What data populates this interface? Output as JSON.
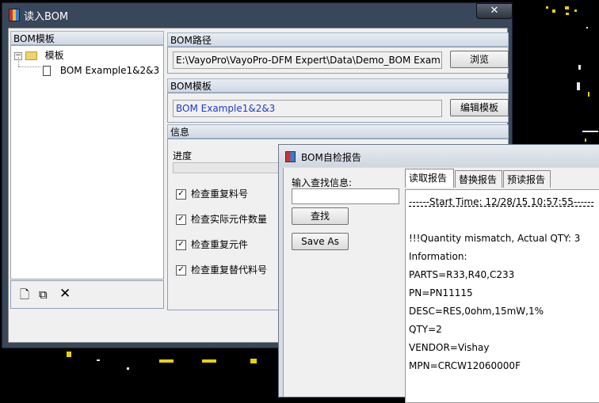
{
  "main_window": {
    "title": "读入BOM",
    "close_label": "✕",
    "left_panel": {
      "header": "BOM模板",
      "tree": {
        "expander": "−",
        "root_label": "模板",
        "child_label": "BOM Example1&2&3"
      }
    },
    "bom_path": {
      "header": "BOM路径",
      "value": "E:\\VayoPro\\VayoPro-DFM Expert\\Data\\Demo_BOM Example",
      "browse_label": "浏览"
    },
    "bom_template": {
      "header": "BOM模板",
      "value": "BOM Example1&2&3",
      "edit_label": "编辑模板"
    },
    "info": {
      "header": "信息",
      "progress_label": "进度",
      "checks": [
        {
          "label": "检查重复料号",
          "checked": true
        },
        {
          "label": "检查实际元件数量",
          "checked": true
        },
        {
          "label": "检查重复元件",
          "checked": true
        },
        {
          "label": "检查重复替代料号",
          "checked": true
        }
      ]
    },
    "toolbar_icons": [
      "new-document-icon",
      "copy-icon",
      "delete-icon"
    ]
  },
  "report_window": {
    "title": "BOM自检报告",
    "search_label": "输入查找信息:",
    "search_value": "",
    "find_button": "查找",
    "save_as_button": "Save As",
    "tabs": [
      "读取报告",
      "替换报告",
      "预读报告"
    ],
    "active_tab": 0,
    "lines": [
      "------Start Time: 12/28/15 10:57:55------",
      "",
      "!!!Quantity mismatch, Actual QTY: 3",
      "Information:",
      " PARTS=R33,R40,C233",
      " PN=PN11115",
      " DESC=RES,0ohm,15mW,1%",
      " QTY=2",
      " VENDOR=Vishay",
      " MPN=CRCW12060000F"
    ]
  },
  "colors": {
    "window_frame": "#39475a",
    "link_text": "#1a3ccf",
    "pcb_marks": "#e6d400"
  }
}
